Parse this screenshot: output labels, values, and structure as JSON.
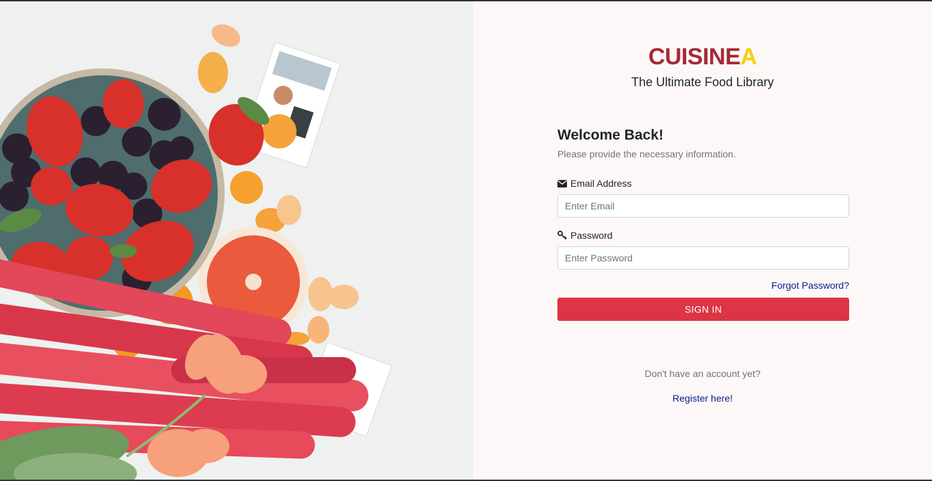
{
  "brand": {
    "main": "CUISINE",
    "accent": "A",
    "tagline": "The Ultimate Food Library"
  },
  "colors": {
    "brand": "#a32b37",
    "accent": "#f4d20d",
    "primary_button": "#dc3545",
    "link": "#0a1b8c"
  },
  "form": {
    "heading": "Welcome Back!",
    "subtitle": "Please provide the necessary information.",
    "email": {
      "label": "Email Address",
      "placeholder": "Enter Email",
      "value": "",
      "icon": "envelope-icon"
    },
    "password": {
      "label": "Password",
      "placeholder": "Enter Password",
      "value": "",
      "icon": "key-icon"
    },
    "forgot_label": "Forgot Password?",
    "submit_label": "SIGN IN"
  },
  "footer": {
    "prompt": "Don't have an account yet?",
    "register_label": "Register here!"
  }
}
